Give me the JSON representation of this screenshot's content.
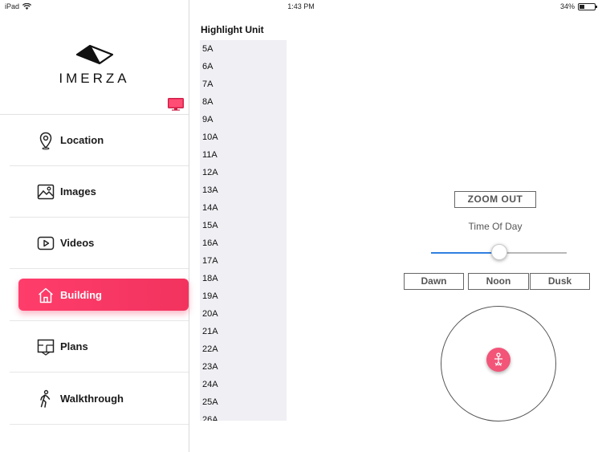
{
  "status_bar": {
    "device": "iPad",
    "time": "1:43 PM",
    "battery": "34%",
    "battery_level": 0.34
  },
  "sidebar": {
    "brand": "IMERZA",
    "items": [
      {
        "label": "Location",
        "icon": "location-pin-icon",
        "active": false
      },
      {
        "label": "Images",
        "icon": "image-icon",
        "active": false
      },
      {
        "label": "Videos",
        "icon": "video-play-icon",
        "active": false
      },
      {
        "label": "Building",
        "icon": "home-icon",
        "active": true
      },
      {
        "label": "Plans",
        "icon": "floor-plan-icon",
        "active": false
      },
      {
        "label": "Walkthrough",
        "icon": "walking-person-icon",
        "active": false
      }
    ]
  },
  "unit_list": {
    "title": "Highlight Unit",
    "units": [
      "5A",
      "6A",
      "7A",
      "8A",
      "9A",
      "10A",
      "11A",
      "12A",
      "13A",
      "14A",
      "15A",
      "16A",
      "17A",
      "18A",
      "19A",
      "20A",
      "21A",
      "22A",
      "23A",
      "24A",
      "25A",
      "26A"
    ]
  },
  "controls": {
    "zoom_out": "ZOOM OUT",
    "time_of_day_label": "Time Of Day",
    "time_of_day_value": 0.5,
    "time_buttons": [
      "Dawn",
      "Noon",
      "Dusk"
    ]
  },
  "colors": {
    "accent": "#f2335e",
    "slider_fill": "#2f7fe0",
    "list_bg": "#efeff4"
  }
}
